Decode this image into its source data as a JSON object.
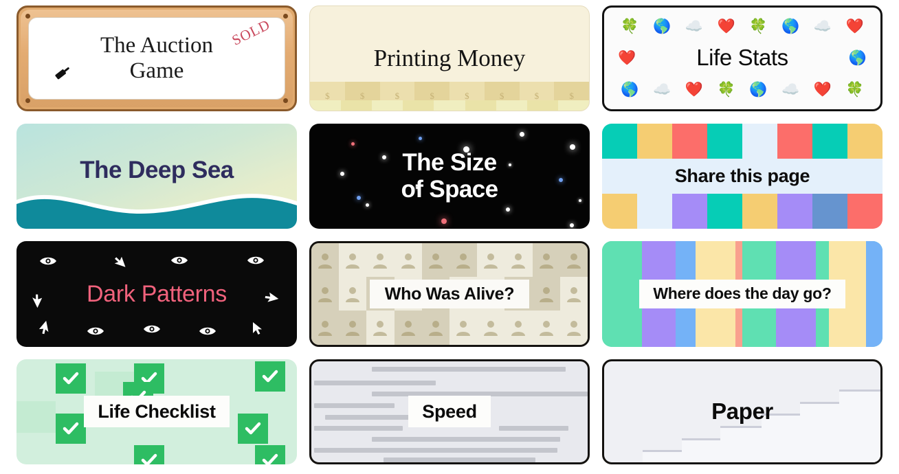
{
  "page": {
    "title": "Card gallery",
    "card_count": 12
  },
  "cards": [
    {
      "id": "auction-game",
      "title": "The Auction\nGame",
      "badge": "SOLD",
      "icon": "gavel-icon",
      "style": "wooden-frame",
      "colors": {
        "frame": "#e0a96d",
        "frame_border": "#8a5a2b",
        "inner": "#ffffff",
        "badge": "#c9485c",
        "text": "#1b1b1b"
      }
    },
    {
      "id": "printing-money",
      "title": "Printing Money",
      "style": "banknote-strip",
      "bill_symbol": "$",
      "colors": {
        "bg": "#f7f1dc",
        "band": "#ecdfae",
        "band_alt": "#e4d49b",
        "symbol": "#c6b276",
        "text": "#141414"
      }
    },
    {
      "id": "life-stats",
      "title": "Life Stats",
      "style": "emoji-border",
      "emoji_top": [
        "clover-icon",
        "earth-globe-icon",
        "cloud-icon",
        "heart-icon",
        "clover-icon",
        "earth-globe-icon",
        "cloud-icon",
        "heart-icon"
      ],
      "emoji_bottom": [
        "earth-globe-icon",
        "cloud-icon",
        "heart-icon",
        "clover-icon",
        "earth-globe-icon",
        "cloud-icon",
        "heart-icon",
        "clover-icon"
      ],
      "emoji_left": "heart-icon",
      "emoji_right": "earth-globe-icon",
      "emoji_glyphs": {
        "clover-icon": "🍀",
        "earth-globe-icon": "🌎",
        "cloud-icon": "☁️",
        "heart-icon": "❤️"
      },
      "colors": {
        "bg": "#fbfbfb",
        "border": "#111111",
        "text": "#0b0b0b"
      }
    },
    {
      "id": "the-deep-sea",
      "title": "The Deep Sea",
      "style": "gradient-wave",
      "colors": {
        "gradient_start": "#b9e3de",
        "gradient_mid": "#cfe8d4",
        "gradient_end": "#edf0c9",
        "wave": "#0f8a9b",
        "text": "#2e2c5e"
      }
    },
    {
      "id": "the-size-of-space",
      "title": "The Size\nof Space",
      "style": "starfield",
      "colors": {
        "bg": "#040404",
        "star_white": "#ffffff",
        "star_blue": "#6f9ff0",
        "star_red": "#f0707a",
        "text": "#ffffff"
      }
    },
    {
      "id": "share-this-page",
      "title": "Share this page",
      "style": "color-tile-grid",
      "colors": {
        "teal": "#06cdb6",
        "yellow": "#f5cd72",
        "coral": "#fc6e6a",
        "purple": "#a58cf7",
        "blue": "#6694cf",
        "pale": "#e4f0fb",
        "text": "#0d0d0d"
      },
      "tiles": [
        "teal",
        "yellow",
        "coral",
        "teal",
        "pale",
        "coral",
        "teal",
        "yellow",
        "blue",
        "pale",
        "pale",
        "pale",
        "pale",
        "pale",
        "pale",
        "pale",
        "yellow",
        "pale",
        "purple",
        "teal",
        "yellow",
        "purple",
        "blue",
        "coral"
      ]
    },
    {
      "id": "dark-patterns",
      "title": "Dark Patterns",
      "style": "eyes-and-cursors",
      "icons": [
        "eye-icon",
        "cursor-arrow-icon",
        "eye-icon",
        "eye-icon",
        "cursor-arrow-icon",
        "cursor-arrow-icon",
        "cursor-arrow-icon",
        "eye-icon",
        "eye-icon",
        "eye-icon",
        "cursor-arrow-icon"
      ],
      "colors": {
        "bg": "#0a0a0a",
        "icon": "#ffffff",
        "text": "#f0627c"
      }
    },
    {
      "id": "who-was-alive",
      "title": "Who Was Alive?",
      "style": "person-grid",
      "icon": "person-silhouette-icon",
      "colors": {
        "bg": "#e6e2d2",
        "border": "#14120f",
        "tile_light": "#eeebdd",
        "tile_dark": "#d6d0ba",
        "person": "#c3bb9c",
        "label_bg": "#fbfaf7",
        "text": "#0c0c0c"
      }
    },
    {
      "id": "where-does-the-day-go",
      "title": "Where does the day go?",
      "style": "vertical-stripes",
      "colors": {
        "mint": "#5fe0b2",
        "purple": "#a58cf7",
        "blue": "#74b2f7",
        "yellow": "#fbe6a8",
        "salmon": "#f9a08e",
        "label_bg": "#fdfdfb",
        "text": "#0d0d0d"
      },
      "stripes": [
        "mint",
        "purple",
        "blue",
        "yellow",
        "salmon",
        "mint",
        "purple",
        "mint",
        "yellow",
        "blue"
      ]
    },
    {
      "id": "life-checklist",
      "title": "Life Checklist",
      "style": "checkmark-grid",
      "icon": "check-icon",
      "colors": {
        "bg": "#d2efdd",
        "check_box": "#2ebd63",
        "check_mark": "#ffffff",
        "label_bg": "#fbfbfa",
        "text": "#0b0b0b"
      }
    },
    {
      "id": "speed",
      "title": "Speed",
      "style": "motion-lines",
      "colors": {
        "bg": "#e8e9ee",
        "border": "#14120f",
        "line": "#c3c5cc",
        "label_bg": "#fcfcfc",
        "text": "#0b0b0b"
      }
    },
    {
      "id": "paper",
      "title": "Paper",
      "style": "paper-stairs",
      "colors": {
        "bg": "#eff0f4",
        "border": "#14120f",
        "sheet": "#f6f7fa",
        "sheet_edge": "#ccced9",
        "text": "#0b0b0b"
      }
    }
  ]
}
